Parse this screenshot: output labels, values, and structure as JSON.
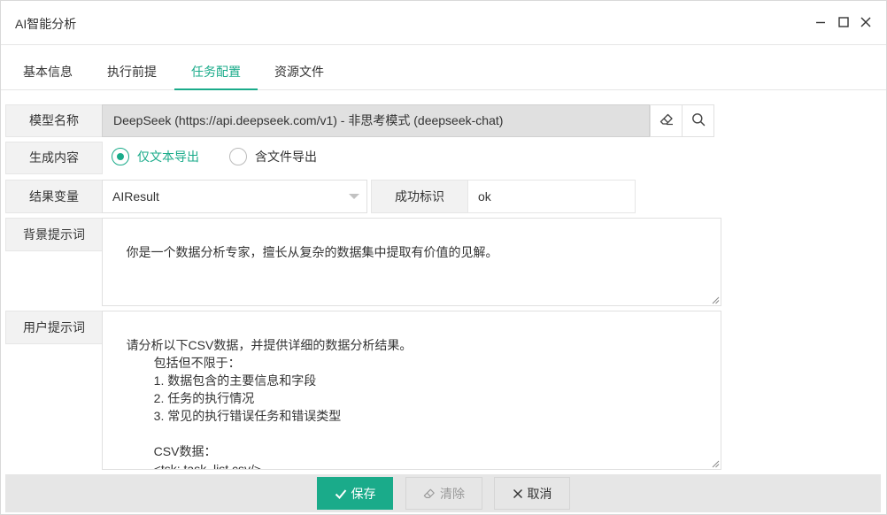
{
  "window": {
    "title": "AI智能分析",
    "controls": {
      "minimize": "minimize-icon",
      "maximize": "maximize-icon",
      "close": "close-icon"
    }
  },
  "tabs": [
    {
      "label": "基本信息",
      "active": false
    },
    {
      "label": "执行前提",
      "active": false
    },
    {
      "label": "任务配置",
      "active": true
    },
    {
      "label": "资源文件",
      "active": false
    }
  ],
  "form": {
    "model": {
      "label": "模型名称",
      "value": "DeepSeek (https://api.deepseek.com/v1) - 非思考模式 (deepseek-chat)",
      "clear_icon": "eraser-icon",
      "search_icon": "search-icon"
    },
    "content": {
      "label": "生成内容",
      "options": [
        {
          "label": "仅文本导出",
          "checked": true
        },
        {
          "label": "含文件导出",
          "checked": false
        }
      ]
    },
    "result": {
      "label": "结果变量",
      "value": "AIResult",
      "success_label": "成功标识",
      "success_value": "ok"
    },
    "background_prompt": {
      "label": "背景提示词",
      "value": "你是一个数据分析专家，擅长从复杂的数据集中提取有价值的见解。"
    },
    "user_prompt": {
      "label": "用户提示词",
      "value": "请分析以下CSV数据，并提供详细的数据分析结果。\n            包括但不限于：\n            1. 数据包含的主要信息和字段\n            2. 任务的执行情况\n            3. 常见的执行错误任务和错误类型\n\n            CSV数据：\n            <tsk: task_list.csv/>"
    }
  },
  "footer": {
    "save_label": "保存",
    "clear_label": "清除",
    "cancel_label": "取消"
  },
  "colors": {
    "accent": "#1aab8a",
    "label_bg": "#f2f2f2",
    "disabled_field_bg": "#e0e0e0",
    "footer_bg": "#e6e6e6"
  }
}
